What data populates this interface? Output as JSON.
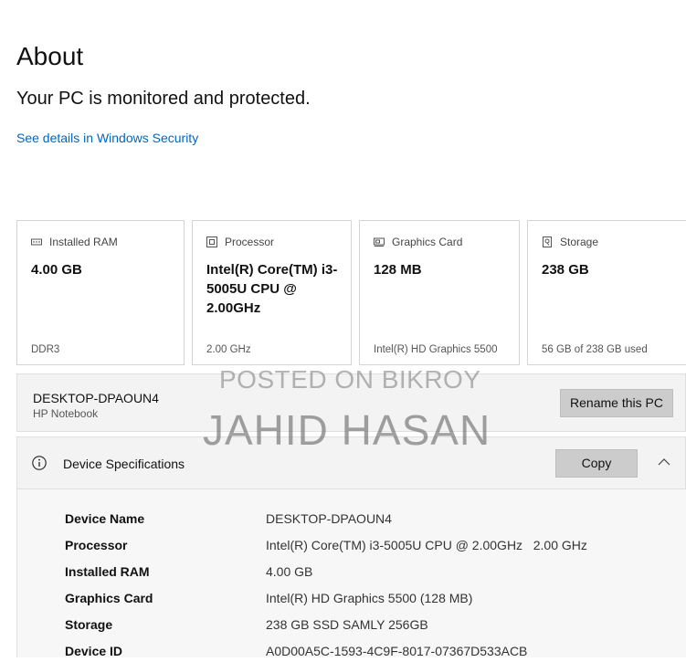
{
  "header": {
    "title": "About",
    "status": "Your PC is monitored and protected.",
    "security_link": "See details in Windows Security"
  },
  "cards": [
    {
      "label": "Installed RAM",
      "value": "4.00 GB",
      "detail": "DDR3",
      "icon": "ram-icon"
    },
    {
      "label": "Processor",
      "value": "Intel(R) Core(TM) i3-5005U CPU @ 2.00GHz",
      "detail": "2.00 GHz",
      "icon": "processor-icon"
    },
    {
      "label": "Graphics Card",
      "value": "128 MB",
      "detail": "Intel(R) HD Graphics 5500",
      "icon": "graphics-card-icon"
    },
    {
      "label": "Storage",
      "value": "238 GB",
      "detail": "56 GB of 238 GB used",
      "icon": "storage-icon"
    }
  ],
  "pc": {
    "name": "DESKTOP-DPAOUN4",
    "model": "HP Notebook",
    "rename_label": "Rename this PC"
  },
  "specs": {
    "title": "Device Specifications",
    "copy_label": "Copy",
    "rows": [
      {
        "key": "Device Name",
        "value": "DESKTOP-DPAOUN4"
      },
      {
        "key": "Processor",
        "value": "Intel(R) Core(TM) i3-5005U CPU @ 2.00GHz   2.00 GHz"
      },
      {
        "key": "Installed RAM",
        "value": "4.00 GB"
      },
      {
        "key": "Graphics Card",
        "value": "Intel(R) HD Graphics 5500 (128 MB)"
      },
      {
        "key": "Storage",
        "value": "238 GB SSD SAMLY 256GB"
      },
      {
        "key": "Device ID",
        "value": "A0D00A5C-1593-4C9F-8017-07367D533ACB"
      }
    ]
  },
  "watermark": {
    "line1": "POSTED ON BIKROY",
    "line2": "JAHID HASAN"
  },
  "colors": {
    "accent": "#0067c0",
    "button": "#cccccc",
    "panel": "#f3f3f3"
  }
}
